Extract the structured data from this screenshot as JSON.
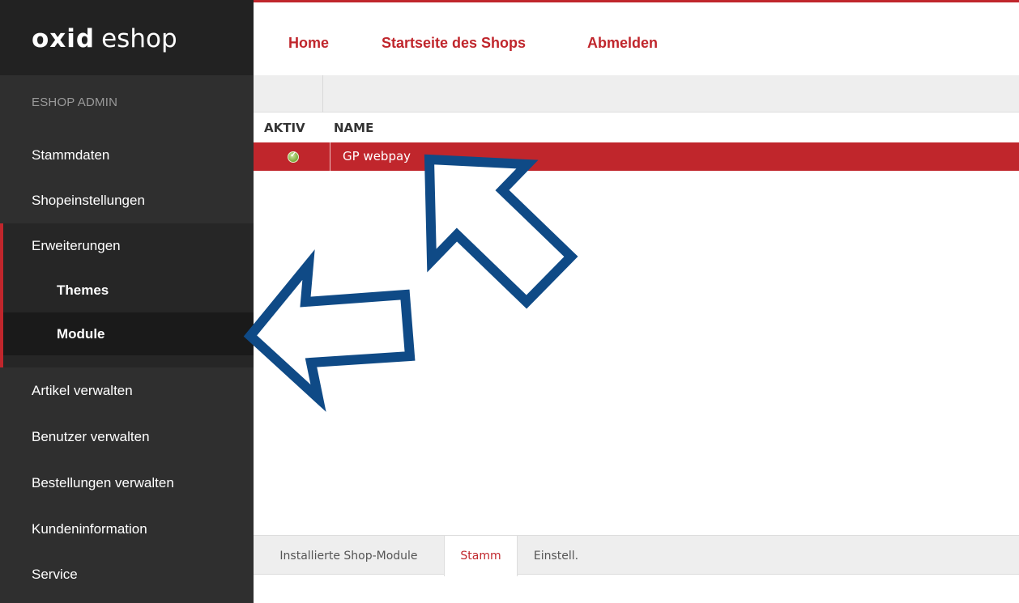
{
  "brand": {
    "name": "OXID",
    "product": "eshop"
  },
  "sidebar": {
    "section_title": "ESHOP ADMIN",
    "items": [
      {
        "label": "Stammdaten"
      },
      {
        "label": "Shopeinstellungen"
      },
      {
        "label": "Erweiterungen"
      },
      {
        "label": "Themes"
      },
      {
        "label": "Module"
      },
      {
        "label": "Artikel verwalten"
      },
      {
        "label": "Benutzer verwalten"
      },
      {
        "label": "Bestellungen verwalten"
      },
      {
        "label": "Kundeninformation"
      },
      {
        "label": "Service"
      }
    ],
    "active_item": "Module"
  },
  "topnav": {
    "links": [
      {
        "label": "Home"
      },
      {
        "label": "Startseite des Shops"
      },
      {
        "label": "Abmelden"
      }
    ]
  },
  "table": {
    "headers": {
      "active": "AKTIV",
      "name": "NAME"
    },
    "rows": [
      {
        "active": true,
        "name": "GP webpay"
      }
    ]
  },
  "tabs": {
    "items": [
      {
        "label": "Installierte Shop-Module"
      },
      {
        "label": "Stamm"
      },
      {
        "label": "Einstell."
      }
    ],
    "active": "Stamm"
  },
  "colors": {
    "accent": "#c0262c",
    "sidebar_bg": "#2f2f2f",
    "annotation_arrow": "#0f4a86"
  },
  "annotations": [
    {
      "type": "arrow",
      "icon": "arrow-up-left-icon",
      "target": "GP webpay"
    },
    {
      "type": "arrow",
      "icon": "arrow-left-icon",
      "target": "Module"
    }
  ]
}
